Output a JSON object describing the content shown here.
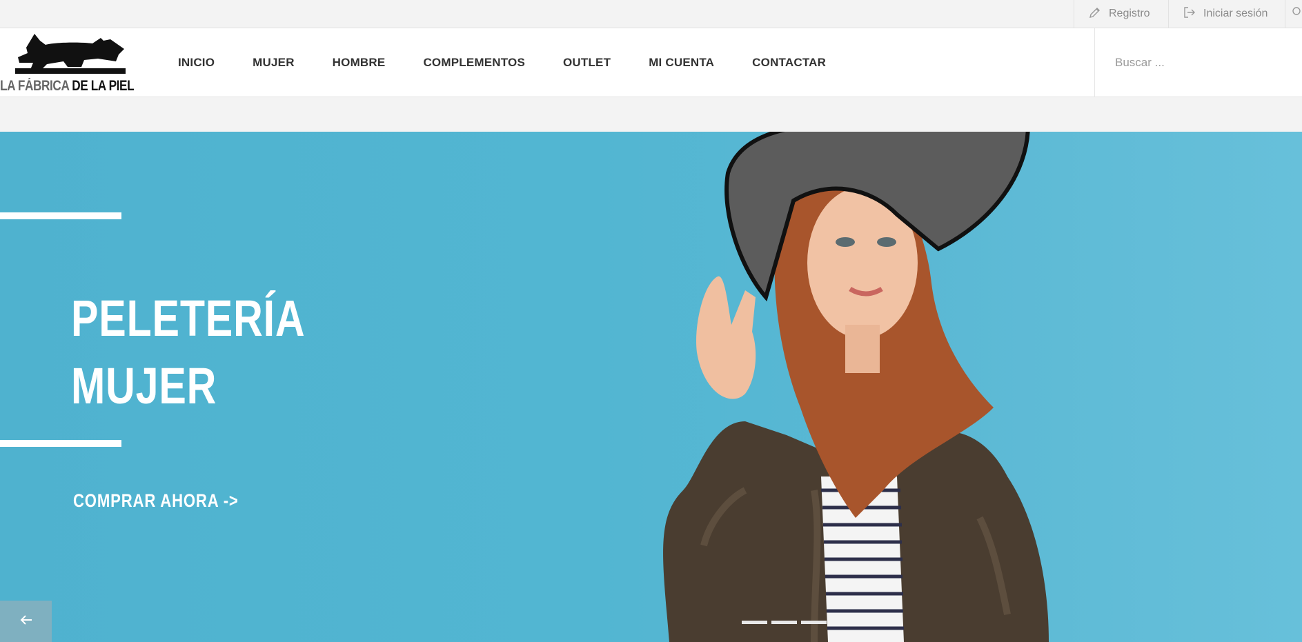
{
  "topbar": {
    "register_label": "Registro",
    "login_label": "Iniciar sesión"
  },
  "header": {
    "logo_text_light": "LA FÁBRICA",
    "logo_text_dark": " DE LA PIEL",
    "nav": [
      {
        "label": "INICIO"
      },
      {
        "label": "MUJER"
      },
      {
        "label": "HOMBRE"
      },
      {
        "label": "COMPLEMENTOS"
      },
      {
        "label": "OUTLET"
      },
      {
        "label": "MI CUENTA"
      },
      {
        "label": "CONTACTAR"
      }
    ],
    "search_placeholder": "Buscar ..."
  },
  "hero": {
    "headline_line1": "PELETERÍA",
    "headline_line2": "MUJER",
    "cta_label": "COMPRAR AHORA ->",
    "prev_arrow": "←",
    "slides_count": 3,
    "background_color": "#52b6d2"
  }
}
